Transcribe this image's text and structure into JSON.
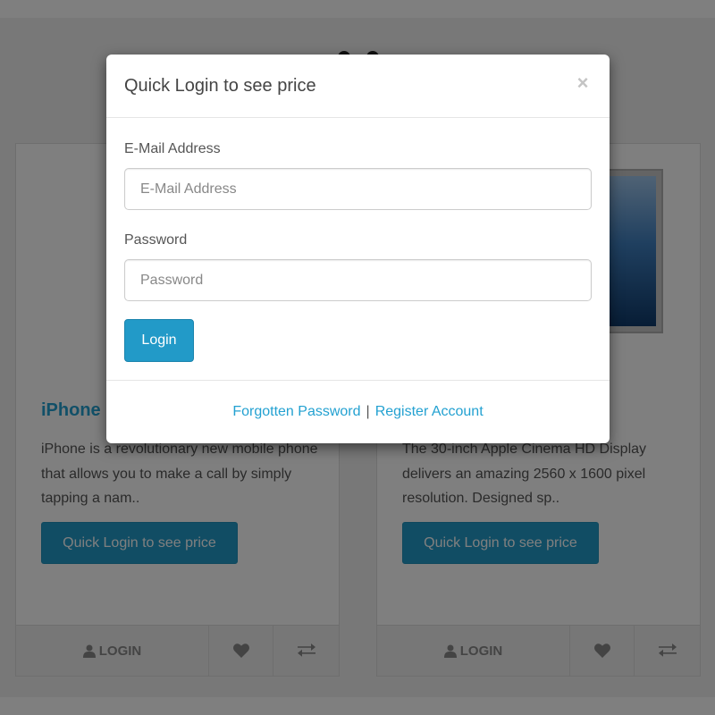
{
  "modal": {
    "title": "Quick Login to see price",
    "close_glyph": "×",
    "email_label": "E-Mail Address",
    "email_placeholder": "E-Mail Address",
    "email_value": "",
    "password_label": "Password",
    "password_placeholder": "Password",
    "password_value": "",
    "login_button": "Login",
    "forgot_link": "Forgotten Password",
    "separator": "|",
    "register_link": "Register Account"
  },
  "products": [
    {
      "name": "iPhone",
      "description": "iPhone is a revolutionary new mobile phone that allows you to make a call by simply tapping a nam..",
      "price_button": "Quick Login to see price",
      "login_button": "LOGIN",
      "wishlist_icon": "heart-icon",
      "compare_icon": "exchange-icon"
    },
    {
      "name": "",
      "description": "The 30-inch Apple Cinema HD Display delivers an amazing 2560 x 1600 pixel resolution. Designed sp..",
      "price_button": "Quick Login to see price",
      "login_button": "LOGIN",
      "wishlist_icon": "heart-icon",
      "compare_icon": "exchange-icon"
    }
  ],
  "colors": {
    "accent": "#229ac8",
    "link": "#23a1d1",
    "overlay": "rgba(0,0,0,0.5)"
  }
}
